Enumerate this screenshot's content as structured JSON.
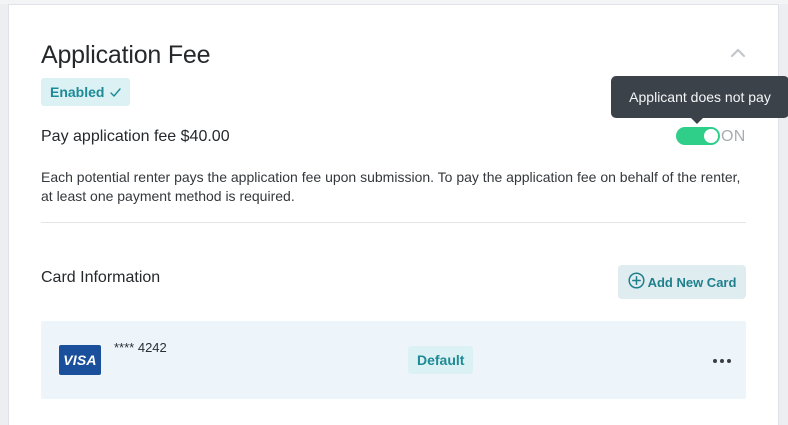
{
  "section": {
    "title": "Application Fee",
    "status_label": "Enabled",
    "fee_label": "Pay application fee $40.00",
    "toggle_state_label": "ON",
    "tooltip_text": "Applicant does not pay",
    "description": "Each potential renter pays the application fee upon submission. To pay the application fee on behalf of the renter, at least one payment method is required."
  },
  "card_info": {
    "heading": "Card Information",
    "add_button_label": "Add New Card",
    "cards": [
      {
        "brand": "VISA",
        "masked_number": "**** 4242",
        "badge": "Default"
      }
    ]
  },
  "colors": {
    "accent_teal": "#1d8a97",
    "badge_bg": "#dcf1f3",
    "toggle_on": "#2fcf8a",
    "visa_blue": "#1a4f9c",
    "row_bg": "#edf5fa"
  },
  "icons": {
    "collapse": "chevron-up-icon",
    "status": "check-icon",
    "add": "plus-circle-icon",
    "more": "more-horizontal-icon"
  }
}
